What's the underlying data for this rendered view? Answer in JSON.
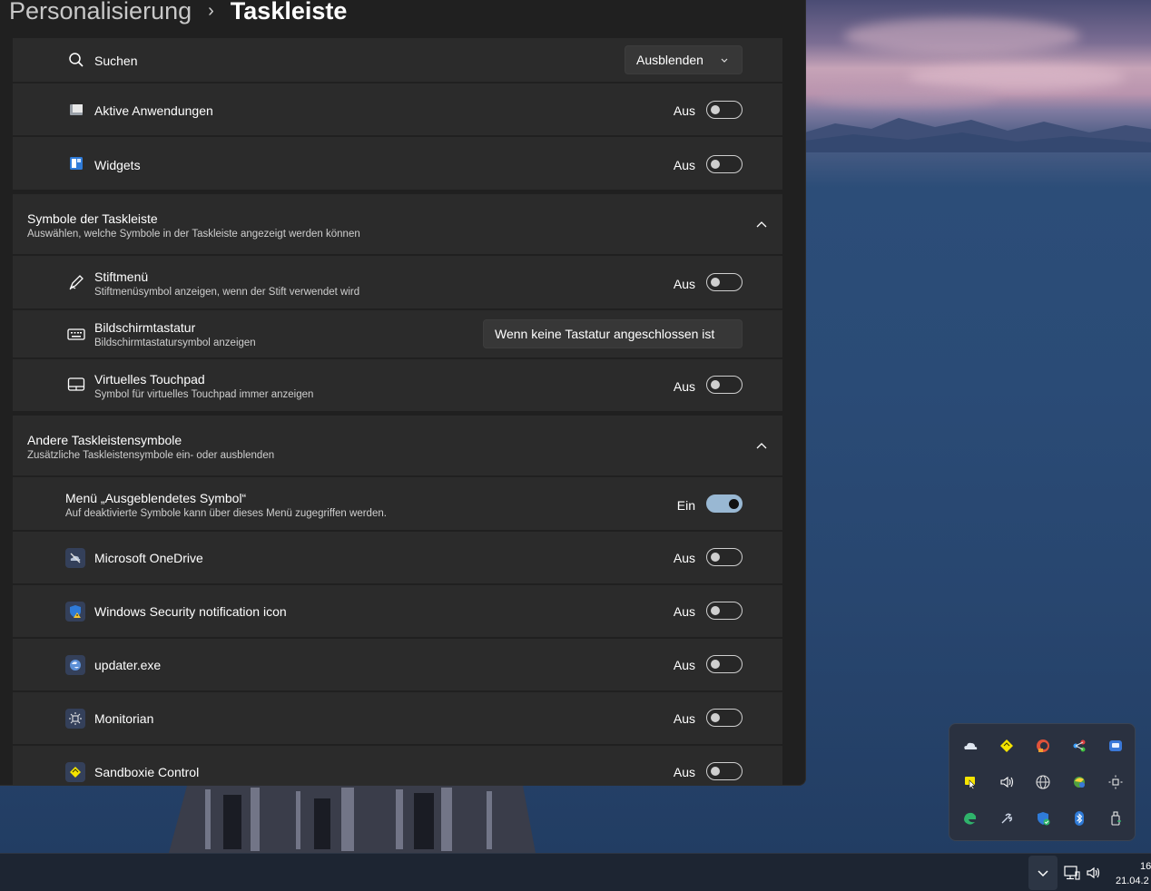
{
  "breadcrumb": {
    "parent": "Personalisierung",
    "separator": "›",
    "current": "Taskleiste"
  },
  "taskbar_items": [
    {
      "label": "Suchen",
      "control": "dropdown",
      "value": "Ausblenden",
      "icon": "search-icon"
    },
    {
      "label": "Aktive Anwendungen",
      "state": "Aus",
      "on": false,
      "icon": "task-view-icon"
    },
    {
      "label": "Widgets",
      "state": "Aus",
      "on": false,
      "icon": "widgets-icon"
    }
  ],
  "symbols_section": {
    "title": "Symbole der Taskleiste",
    "subtitle": "Auswählen, welche Symbole in der Taskleiste angezeigt werden können",
    "items": [
      {
        "label": "Stiftmenü",
        "sub": "Stiftmenüsymbol anzeigen, wenn der Stift verwendet wird",
        "state": "Aus",
        "on": false,
        "icon": "pen-icon"
      },
      {
        "label": "Bildschirmtastatur",
        "sub": "Bildschirmtastatursymbol anzeigen",
        "control": "dropdown",
        "value": "Wenn keine Tastatur angeschlossen ist",
        "icon": "keyboard-icon"
      },
      {
        "label": "Virtuelles Touchpad",
        "sub": "Symbol für virtuelles Touchpad immer anzeigen",
        "state": "Aus",
        "on": false,
        "icon": "touchpad-icon"
      }
    ]
  },
  "other_section": {
    "title": "Andere Taskleistensymbole",
    "subtitle": "Zusätzliche Taskleistensymbole ein- oder ausblenden",
    "hidden_menu": {
      "label": "Menü „Ausgeblendetes Symbol“",
      "sub": "Auf deaktivierte Symbole kann über dieses Menü zugegriffen werden.",
      "state": "Ein",
      "on": true
    },
    "apps": [
      {
        "label": "Microsoft OneDrive",
        "state": "Aus",
        "on": false,
        "icon": "onedrive-icon"
      },
      {
        "label": "Windows Security notification icon",
        "state": "Aus",
        "on": false,
        "icon": "windows-security-icon"
      },
      {
        "label": "updater.exe",
        "state": "Aus",
        "on": false,
        "icon": "updater-icon"
      },
      {
        "label": "Monitorian",
        "state": "Aus",
        "on": false,
        "icon": "monitorian-icon"
      },
      {
        "label": "Sandboxie Control",
        "state": "Aus",
        "on": false,
        "icon": "sandboxie-icon"
      }
    ]
  },
  "tray_flyout_icons": [
    "onedrive-icon",
    "sandboxie-icon",
    "ccleaner-icon",
    "network-app-icon",
    "remote-desktop-icon",
    "pointer-app-icon",
    "volume-icon",
    "globe-icon",
    "updater-icon",
    "brightness-icon",
    "edge-icon",
    "tools-icon",
    "windows-security-icon",
    "bluetooth-icon",
    "usb-eject-icon"
  ],
  "taskbar": {
    "time": "16",
    "date": "21.04.2"
  },
  "colors": {
    "window_bg": "#202020",
    "card_bg": "#2b2b2b",
    "accent_toggle": "#99b8d3",
    "taskbar_bg": "#1d2532"
  }
}
